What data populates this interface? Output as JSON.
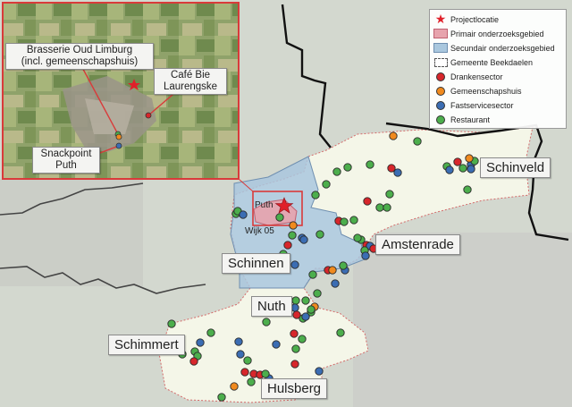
{
  "legend": {
    "items": [
      {
        "label": "Projectlocatie",
        "symbol": "star-icon",
        "color": "#e0202a"
      },
      {
        "label": "Primair onderzoeksgebied",
        "symbol": "swatch-icon",
        "color": "#e7a3ad"
      },
      {
        "label": "Secundair onderzoeksgebied",
        "symbol": "swatch-icon",
        "color": "#a9c7de"
      },
      {
        "label": "Gemeente Beekdaelen",
        "symbol": "dashed-swatch-icon",
        "color": "#ffffff"
      },
      {
        "label": "Drankensector",
        "symbol": "dot-icon",
        "color": "#d7262b"
      },
      {
        "label": "Gemeenschapshuis",
        "symbol": "dot-icon",
        "color": "#f08a1e"
      },
      {
        "label": "Fastservicesector",
        "symbol": "dot-icon",
        "color": "#3b6db3"
      },
      {
        "label": "Restaurant",
        "symbol": "dot-icon",
        "color": "#4cae4c"
      }
    ]
  },
  "places": {
    "schinveld": "Schinveld",
    "amstenrade": "Amstenrade",
    "schinnen": "Schinnen",
    "nuth": "Nuth",
    "schimmert": "Schimmert",
    "hulsberg": "Hulsberg",
    "puth": "Puth",
    "wijk": "Wijk 05"
  },
  "inset": {
    "brasserie": "Brasserie Oud Limburg\n(incl. gemeenschapshuis)",
    "cafe": "Café Bie\nLaurengske",
    "snackpoint": "Snackpoint\nPuth"
  }
}
